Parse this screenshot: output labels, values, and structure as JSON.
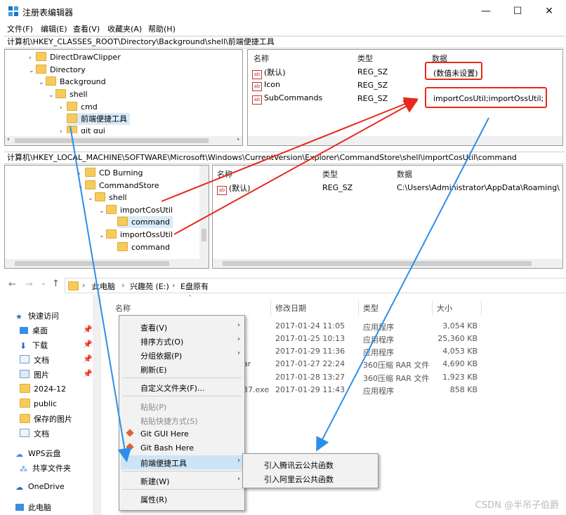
{
  "window": {
    "title": "注册表编辑器",
    "minimize": "—",
    "maximize": "☐",
    "close": "✕"
  },
  "menu": [
    "文件(F)",
    "编辑(E)",
    "查看(V)",
    "收藏夹(A)",
    "帮助(H)"
  ],
  "reg1": {
    "address": "计算机\\HKEY_CLASSES_ROOT\\Directory\\Background\\shell\\前端便捷工具",
    "tree": [
      "DirectDrawClipper",
      "Directory",
      "Background",
      "shell",
      "cmd",
      "前端便捷工具",
      "git gui"
    ],
    "headers": {
      "name": "名称",
      "type": "类型",
      "data": "数据"
    },
    "values": [
      {
        "name": "(默认)",
        "type": "REG_SZ",
        "data": "(数值未设置)"
      },
      {
        "name": "Icon",
        "type": "REG_SZ",
        "data": ""
      },
      {
        "name": "SubCommands",
        "type": "REG_SZ",
        "data": "importCosUtil;importOssUtil;"
      }
    ]
  },
  "reg2": {
    "address": "计算机\\HKEY_LOCAL_MACHINE\\SOFTWARE\\Microsoft\\Windows\\CurrentVersion\\Explorer\\CommandStore\\shell\\importCosUtil\\command",
    "tree": [
      "CD Burning",
      "CommandStore",
      "shell",
      "importCosUtil",
      "command",
      "importOssUtil",
      "command"
    ],
    "headers": {
      "name": "名称",
      "type": "类型",
      "data": "数据"
    },
    "values": [
      {
        "name": "(默认)",
        "type": "REG_SZ",
        "data": "C:\\Users\\Administrator\\AppData\\Roaming\\nv"
      }
    ]
  },
  "explorer": {
    "breadcrumb": [
      "此电脑",
      "兴趣苑 (E:)",
      "E盘原有"
    ],
    "nav": [
      "快速访问",
      "桌面",
      "下载",
      "文档",
      "图片",
      "2024-12",
      "public",
      "保存的图片",
      "文档",
      "WPS云盘",
      "共享文件夹",
      "OneDrive",
      "此电脑"
    ],
    "columns": {
      "name": "名称",
      "date": "修改日期",
      "type": "类型",
      "size": "大小"
    },
    "files": [
      {
        "name": "",
        "date": "2017-01-24 11:05",
        "type": "应用程序",
        "size": "3,054 KB"
      },
      {
        "name": "",
        "date": "2017-01-25 10:13",
        "type": "应用程序",
        "size": "25,360 KB"
      },
      {
        "name": "",
        "date": "2017-01-29 11:36",
        "type": "应用程序",
        "size": "4,053 KB"
      },
      {
        "name": "ar",
        "date": "2017-01-27 22:24",
        "type": "360压缩 RAR 文件",
        "size": "4,690 KB"
      },
      {
        "name": "",
        "date": "2017-01-28 13:27",
        "type": "360压缩 RAR 文件",
        "size": "1,923 KB"
      },
      {
        "name": "37.exe",
        "date": "2017-01-29 11:43",
        "type": "应用程序",
        "size": "858 KB"
      }
    ]
  },
  "context_menu": {
    "items": [
      {
        "label": "查看(V)",
        "arrow": "›"
      },
      {
        "label": "排序方式(O)",
        "arrow": "›"
      },
      {
        "label": "分组依据(P)",
        "arrow": "›"
      },
      {
        "label": "刷新(E)"
      },
      {
        "label": "自定义文件夹(F)..."
      },
      {
        "label": "粘贴(P)"
      },
      {
        "label": "粘贴快捷方式(S)"
      },
      {
        "label": "Git GUI Here"
      },
      {
        "label": "Git Bash Here"
      },
      {
        "label": "前端便捷工具",
        "arrow": "›"
      },
      {
        "label": "新建(W)",
        "arrow": "›"
      },
      {
        "label": "属性(R)"
      }
    ],
    "submenu": [
      "引入腾讯云公共函数",
      "引入阿里云公共函数"
    ]
  },
  "watermark": "CSDN @半吊子伯爵",
  "colors": {
    "annotation_red": "#e8291d",
    "annotation_blue": "#2b8fe8",
    "selection": "#d9ebf9",
    "folder": "#f5cb5c"
  }
}
